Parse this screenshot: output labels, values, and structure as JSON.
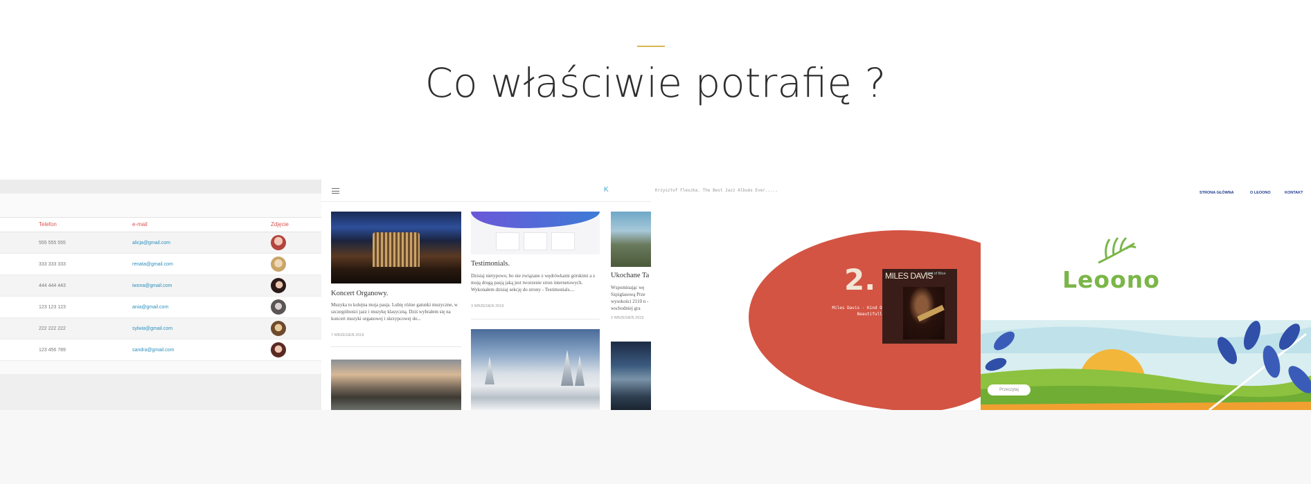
{
  "section": {
    "title": "Co właściwie potrafię ?",
    "accent_color": "#d8b64e"
  },
  "portfolio": {
    "contacts_table": {
      "headers": [
        "Telefon",
        "e-mail",
        "Zdjęcie"
      ],
      "rows": [
        {
          "phone": "555 555 555",
          "email": "alicja@gmail.com"
        },
        {
          "phone": "333 333 333",
          "email": "renata@gmail.com"
        },
        {
          "phone": "444 444 443",
          "email": "iwona@gmail.com"
        },
        {
          "phone": "123 123 123",
          "email": "ania@gmail.com"
        },
        {
          "phone": "222 222 222",
          "email": "sylwia@gmail.com"
        },
        {
          "phone": "123 456 789",
          "email": "sandra@gmail.com"
        }
      ]
    },
    "blog": {
      "logo": "K",
      "posts": [
        {
          "title": "Koncert Organowy.",
          "text": "Muzyka to kolejna moja pasja. Lubię różne gatunki muzyczne, w szczególności jazz i muzykę klasyczną. Dziś wybrałem się na koncert muzyki organowej i skrzypcowej do...",
          "date": "7 WRZESIEŃ 2019"
        },
        {
          "title": "Testimonials.",
          "text": "Dzisiaj nietypowo, bo nie związane z wędrówkami górskimi a z moją drugą pasją jaką jest tworzenie stron internetowych. Wykonałem dzisiaj sekcję do strony - Testimonials....",
          "date": "3 WRZESIEŃ 2019"
        },
        {
          "title": "Ukochane Ta",
          "text": "Wspominając wę Szpiglasową Prze wysokości 2110 n - wschodniej gra",
          "date": "2 WRZESIEŃ 2019"
        }
      ]
    },
    "album": {
      "crumb": "Krzysztof Fleszka. The Best Jazz Albums Ever.....",
      "number": "2.",
      "caption": "Miles Davis - Kind Of Blue. Beautifull album.",
      "cover_artist": "MILES DAVIS",
      "cover_title": "Kind of Blue",
      "blob_color": "#d35443"
    },
    "leoono": {
      "menu": [
        "STRONA GŁÓWNA",
        "O LEOONO",
        "KONTAKT"
      ],
      "brand": "Leoono",
      "button": "Przeczytaj",
      "brand_color": "#7ab648"
    }
  }
}
